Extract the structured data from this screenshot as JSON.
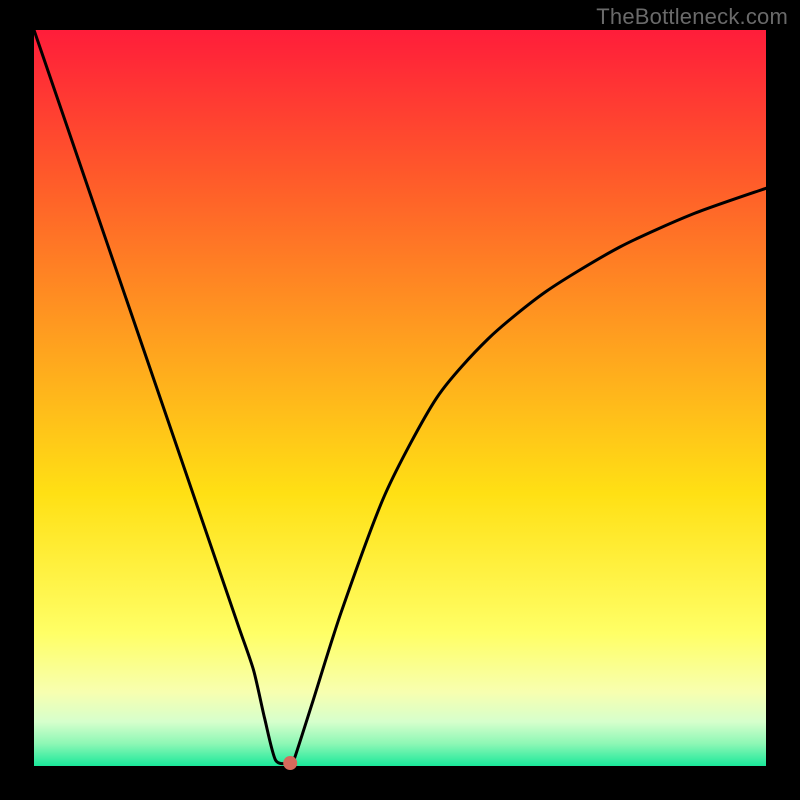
{
  "watermark": "TheBottleneck.com",
  "chart_data": {
    "type": "line",
    "title": "",
    "xlabel": "",
    "ylabel": "",
    "xlim": [
      0,
      100
    ],
    "ylim": [
      0,
      100
    ],
    "grid": false,
    "legend": false,
    "background_gradient": {
      "direction": "vertical",
      "stops": [
        {
          "pos": 0.0,
          "color": "#ff1d3a"
        },
        {
          "pos": 0.2,
          "color": "#ff5a2a"
        },
        {
          "pos": 0.42,
          "color": "#ff9f1f"
        },
        {
          "pos": 0.63,
          "color": "#ffe014"
        },
        {
          "pos": 0.82,
          "color": "#ffff66"
        },
        {
          "pos": 0.9,
          "color": "#f7ffb0"
        },
        {
          "pos": 0.94,
          "color": "#d6ffcc"
        },
        {
          "pos": 0.97,
          "color": "#8cf7b5"
        },
        {
          "pos": 1.0,
          "color": "#1ae89a"
        }
      ]
    },
    "series": [
      {
        "name": "bottleneck-curve",
        "x": [
          0,
          5,
          10,
          15,
          20,
          25,
          28,
          30,
          31.5,
          33,
          35,
          35.5,
          38,
          42,
          48,
          55,
          62,
          70,
          80,
          90,
          100
        ],
        "values": [
          100,
          85.5,
          71,
          56.5,
          42,
          27.5,
          18.8,
          13,
          6.5,
          0.8,
          0.4,
          0.8,
          8.5,
          21,
          37,
          50,
          58,
          64.5,
          70.5,
          75,
          78.5
        ]
      }
    ],
    "marker": {
      "name": "optimal-point",
      "x": 35,
      "y": 0.4,
      "color": "#d66a5c",
      "radius_px": 7
    }
  }
}
